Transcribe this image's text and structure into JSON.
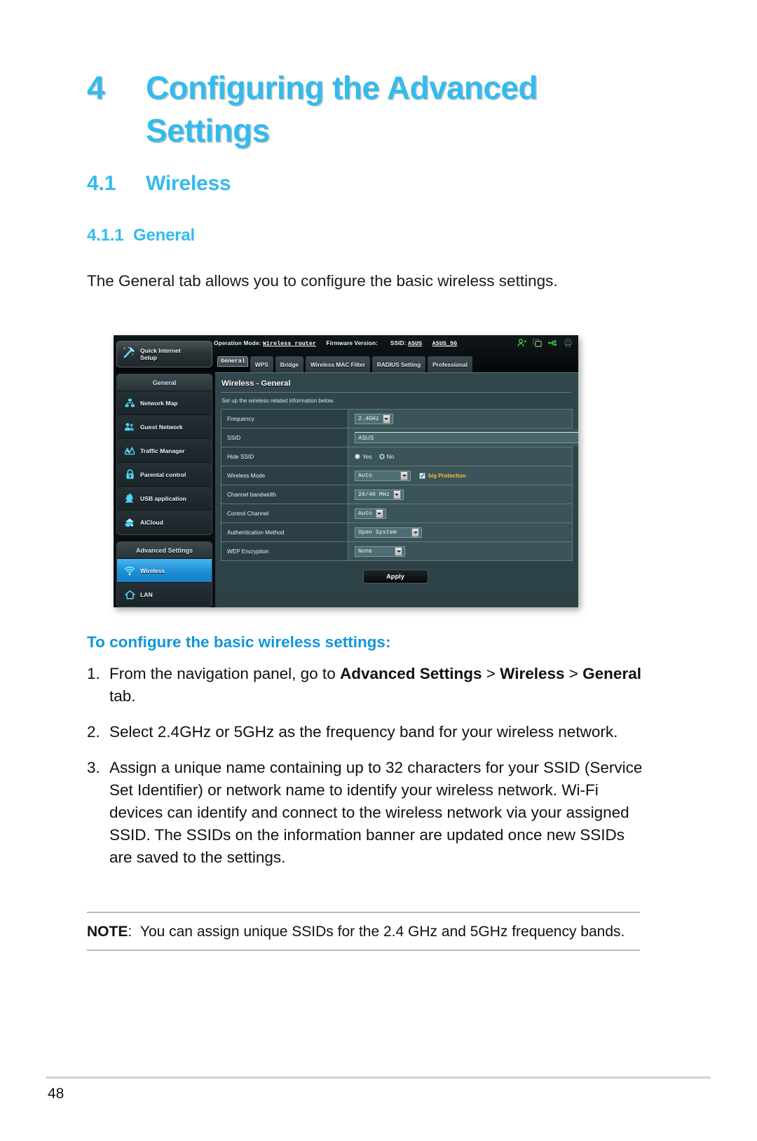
{
  "document": {
    "chapter_number": "4",
    "chapter_title": "Configuring the Advanced Settings",
    "section_number": "4.1",
    "section_title": "Wireless",
    "subsection_number": "4.1.1",
    "subsection_title": "General",
    "intro_paragraph": "The General tab allows you to configure the basic wireless settings.",
    "page_number": "48",
    "accent_color": "#33bbee",
    "bold_accent_color": "#1296d8"
  },
  "howto": {
    "heading": "To configure the basic wireless settings:",
    "steps": [
      {
        "number": "1.",
        "parts": [
          {
            "text": "From the navigation panel, go to ",
            "bold": false
          },
          {
            "text": "Advanced Settings",
            "bold": true
          },
          {
            "text": " > ",
            "bold": false
          },
          {
            "text": "Wireless",
            "bold": true
          },
          {
            "text": " > ",
            "bold": false
          },
          {
            "text": "General",
            "bold": true
          },
          {
            "text": " tab.",
            "bold": false
          }
        ]
      },
      {
        "number": "2.",
        "parts": [
          {
            "text": "Select 2.4GHz or 5GHz as the frequency band for your wireless network.",
            "bold": false
          }
        ]
      },
      {
        "number": "3.",
        "parts": [
          {
            "text": "Assign a unique name containing up to 32 characters for your SSID (Service Set Identifier) or network name to identify your wireless network. Wi-Fi devices can identify and connect to the wireless network via your assigned SSID. The SSIDs on the information banner are updated once new SSIDs are saved to the settings.",
            "bold": false
          }
        ]
      }
    ]
  },
  "note": {
    "label": "NOTE",
    "separator": ":",
    "text": "You can assign unique SSIDs for the 2.4 GHz and 5GHz frequency bands."
  },
  "router_ui": {
    "topbar": {
      "operation_mode_label": "Operation Mode:",
      "operation_mode_value": "Wireless router",
      "firmware_label": "Firmware Version:",
      "firmware_value": "",
      "ssid_label": "SSID:",
      "ssid_value_1": "ASUS",
      "ssid_value_2": "ASUS_5G",
      "icons": [
        "user-icon",
        "copy-icon",
        "usb-icon",
        "printer-icon"
      ]
    },
    "quick_internet_setup": {
      "line1": "Quick Internet",
      "line2": "Setup",
      "icon": "magic-wand-icon"
    },
    "nav_general": {
      "header": "General",
      "items": [
        {
          "label": "Network Map",
          "icon": "network-map-icon"
        },
        {
          "label": "Guest Network",
          "icon": "guest-network-icon"
        },
        {
          "label": "Traffic Manager",
          "icon": "traffic-manager-icon"
        },
        {
          "label": "Parental control",
          "icon": "lock-icon"
        },
        {
          "label": "USB application",
          "icon": "puzzle-icon"
        },
        {
          "label": "AiCloud",
          "icon": "cloud-house-icon"
        }
      ]
    },
    "nav_advanced": {
      "header": "Advanced Settings",
      "items": [
        {
          "label": "Wireless",
          "icon": "wifi-icon",
          "active": true
        },
        {
          "label": "LAN",
          "icon": "home-icon",
          "active": false
        }
      ]
    },
    "tabs": [
      {
        "label": "General",
        "selected": true
      },
      {
        "label": "WPS",
        "selected": false
      },
      {
        "label": "Bridge",
        "selected": false
      },
      {
        "label": "Wireless MAC Filter",
        "selected": false
      },
      {
        "label": "RADIUS Setting",
        "selected": false
      },
      {
        "label": "Professional",
        "selected": false
      }
    ],
    "panel": {
      "title": "Wireless - General",
      "subtitle": "Set up the wireless related information below.",
      "rows": [
        {
          "label": "Frequency",
          "control": "select",
          "value": "2.4GHz"
        },
        {
          "label": "SSID",
          "control": "text",
          "value": "ASUS"
        },
        {
          "label": "Hide SSID",
          "control": "radio",
          "options": [
            "Yes",
            "No"
          ],
          "selected": "No"
        },
        {
          "label": "Wireless Mode",
          "control": "select-check",
          "value": "Auto",
          "checkbox_label": "b/g Protection",
          "checked": true
        },
        {
          "label": "Channel bandwidth",
          "control": "select",
          "value": "20/40 MHz"
        },
        {
          "label": "Control Channel",
          "control": "select",
          "value": "Auto"
        },
        {
          "label": "Authentication Method",
          "control": "select",
          "value": "Open System"
        },
        {
          "label": "WEP Encryption",
          "control": "select",
          "value": "None"
        }
      ],
      "apply_button": "Apply"
    }
  }
}
